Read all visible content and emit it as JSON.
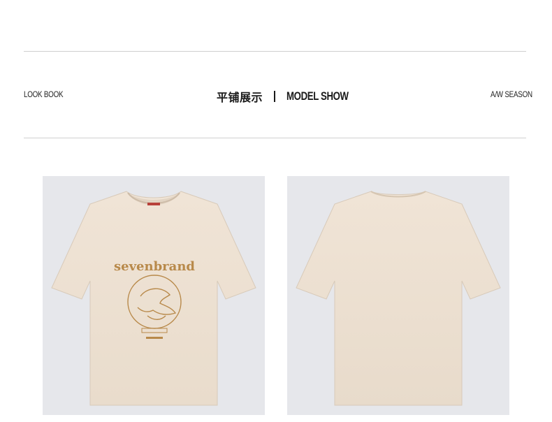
{
  "header": {
    "left_label": "LOOK BOOK",
    "center_zh": "平铺展示",
    "center_en": "MODEL SHOW",
    "right_label": "A/W SEASON"
  },
  "photos": [
    {
      "view": "front",
      "print_brand": "sevenbrand"
    },
    {
      "view": "back"
    }
  ],
  "colors": {
    "shirt": "#eee0d1",
    "print": "#b8894a",
    "photo_bg": "#e6e7eb",
    "rule": "#cfcfcf"
  }
}
